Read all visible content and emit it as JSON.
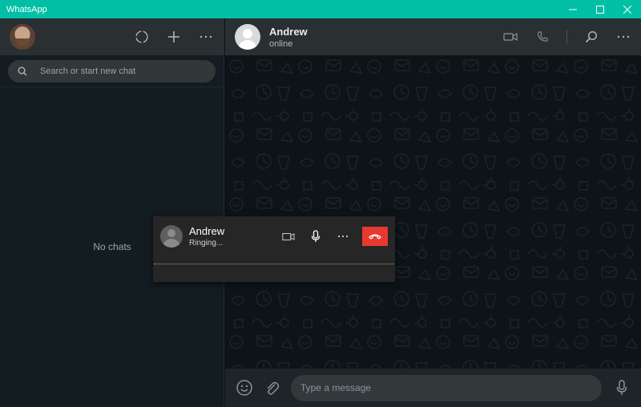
{
  "window": {
    "title": "WhatsApp",
    "accent_color": "#00bfa5"
  },
  "sidebar": {
    "actions": [
      "status-icon",
      "new-chat-icon",
      "menu-icon"
    ],
    "search": {
      "placeholder": "Search or start new chat"
    },
    "empty_text": "No chats"
  },
  "chat": {
    "contact_name": "Andrew",
    "contact_status": "online",
    "actions": [
      "video-call-icon",
      "voice-call-icon",
      "search-icon",
      "menu-icon"
    ],
    "composer": {
      "placeholder": "Type a message"
    }
  },
  "call": {
    "name": "Andrew",
    "status": "Ringing...",
    "actions": [
      "video-icon",
      "mic-icon",
      "more-icon",
      "end-call-icon"
    ],
    "end_call_color": "#e8392f"
  }
}
